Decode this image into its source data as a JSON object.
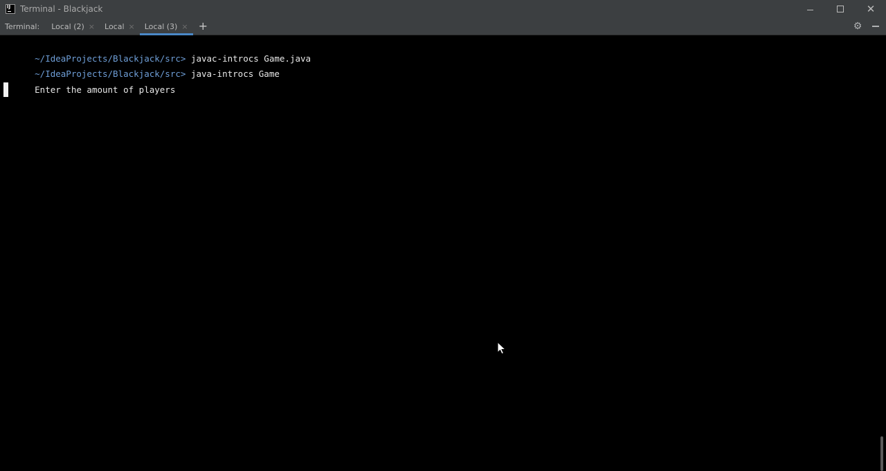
{
  "window": {
    "title": "Terminal - Blackjack",
    "logo_text": "IJ",
    "controls": {
      "minimize_icon": "minimize-icon",
      "maximize_icon": "maximize-icon",
      "close_glyph": "✕"
    }
  },
  "tabbar": {
    "prefix": "Terminal:",
    "tabs": [
      {
        "label": "Local (2)",
        "active": false,
        "close_glyph": "×"
      },
      {
        "label": "Local",
        "active": false,
        "close_glyph": "×"
      },
      {
        "label": "Local (3)",
        "active": true,
        "close_glyph": "×"
      }
    ],
    "add_glyph": "+",
    "gear_glyph": "⚙",
    "hide_icon": "minus-icon"
  },
  "terminal": {
    "lines": [
      {
        "prompt": "~/IdeaProjects/Blackjack/src>",
        "command": " javac-introcs Game.java"
      },
      {
        "prompt": "~/IdeaProjects/Blackjack/src>",
        "command": " java-introcs Game"
      },
      {
        "prompt": "",
        "command": "Enter the amount of players"
      }
    ]
  },
  "colors": {
    "chrome_bg": "#3c3f41",
    "terminal_bg": "#000000",
    "prompt_path": "#6f9fd8",
    "active_tab_underline": "#4a88c7"
  }
}
